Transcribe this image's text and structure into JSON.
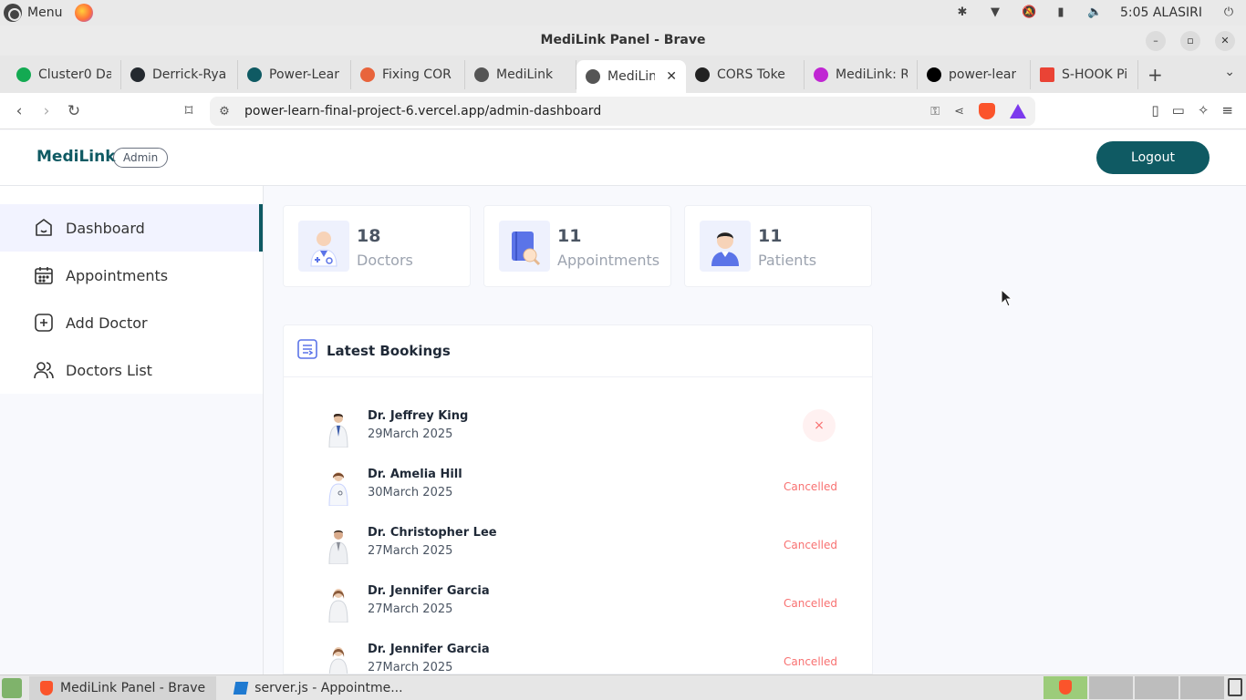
{
  "system_panel": {
    "menu_label": "Menu",
    "clock": "5:05 ALASIRI"
  },
  "window": {
    "title": "MediLink Panel - Brave"
  },
  "tabs": [
    {
      "label": "Cluster0 Da",
      "color": "#13aa52"
    },
    {
      "label": "Derrick-Rya",
      "color": "#24292f"
    },
    {
      "label": "Power-Lear",
      "color": "#0f5a63"
    },
    {
      "label": "Fixing COR",
      "color": "#e8643c"
    },
    {
      "label": "MediLink",
      "color": "#555555"
    },
    {
      "label": "MediLin",
      "color": "#555555"
    },
    {
      "label": "CORS Toke",
      "color": "#222222"
    },
    {
      "label": "MediLink: R",
      "color": "#c026d3"
    },
    {
      "label": "power-lear",
      "color": "#000000"
    },
    {
      "label": "S-HOOK Pi",
      "color": "#ea4335"
    }
  ],
  "address_bar": {
    "url": "power-learn-final-project-6.vercel.app/admin-dashboard"
  },
  "header": {
    "brand": "MediLink",
    "role_badge": "Admin",
    "logout_label": "Logout",
    "accent_color": "#0f5a63"
  },
  "sidebar": {
    "items": [
      {
        "label": "Dashboard",
        "icon": "home-icon",
        "active": true
      },
      {
        "label": "Appointments",
        "icon": "calendar-icon",
        "active": false
      },
      {
        "label": "Add Doctor",
        "icon": "add-square-icon",
        "active": false
      },
      {
        "label": "Doctors List",
        "icon": "people-icon",
        "active": false
      }
    ]
  },
  "stats": [
    {
      "value": "18",
      "label": "Doctors",
      "icon": "doctor-icon"
    },
    {
      "value": "11",
      "label": "Appointments",
      "icon": "appointments-icon"
    },
    {
      "value": "11",
      "label": "Patients",
      "icon": "patient-icon"
    }
  ],
  "latest_bookings": {
    "title": "Latest Bookings",
    "rows": [
      {
        "doctor": "Dr. Jeffrey King",
        "date": "29March 2025",
        "status": "",
        "action": "×"
      },
      {
        "doctor": "Dr. Amelia Hill",
        "date": "30March 2025",
        "status": "Cancelled"
      },
      {
        "doctor": "Dr. Christopher Lee",
        "date": "27March 2025",
        "status": "Cancelled"
      },
      {
        "doctor": "Dr. Jennifer Garcia",
        "date": "27March 2025",
        "status": "Cancelled"
      },
      {
        "doctor": "Dr. Jennifer Garcia",
        "date": "27March 2025",
        "status": "Cancelled"
      }
    ]
  },
  "taskbar": {
    "items": [
      {
        "label": "MediLink Panel - Brave",
        "active": true
      },
      {
        "label": "server.js - Appointme...",
        "active": false
      }
    ]
  }
}
